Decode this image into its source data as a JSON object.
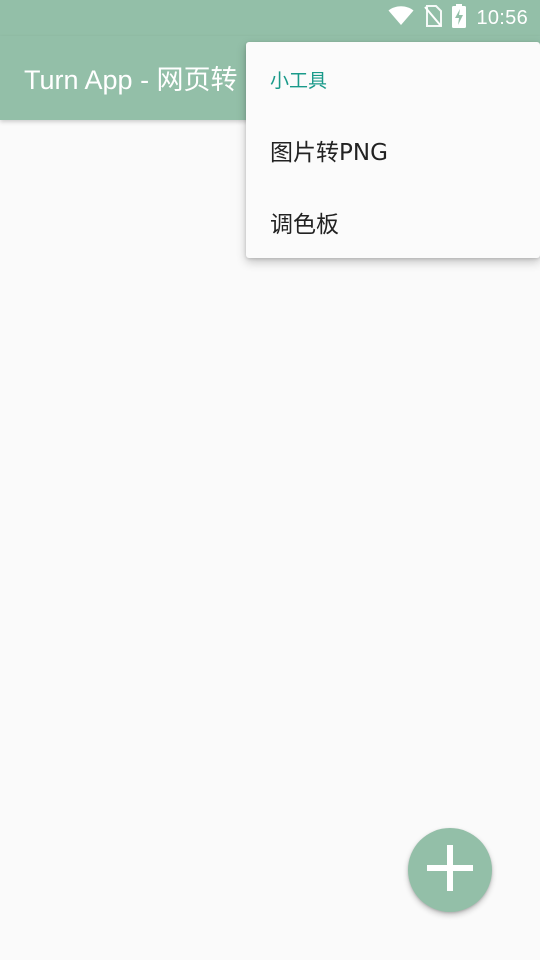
{
  "status_bar": {
    "time": "10:56",
    "icons": [
      "wifi-icon",
      "no-sim-icon",
      "battery-charging-icon"
    ]
  },
  "app_bar": {
    "title": "Turn App - 网页转"
  },
  "overflow_menu": {
    "header": "小工具",
    "items": [
      {
        "label": "图片转PNG"
      },
      {
        "label": "调色板"
      }
    ]
  },
  "fab": {
    "icon": "plus-icon"
  },
  "colors": {
    "primary": "#93bfa8",
    "accent_text": "#1a9a8a",
    "background": "#fafafa",
    "menu_text": "#222222"
  }
}
